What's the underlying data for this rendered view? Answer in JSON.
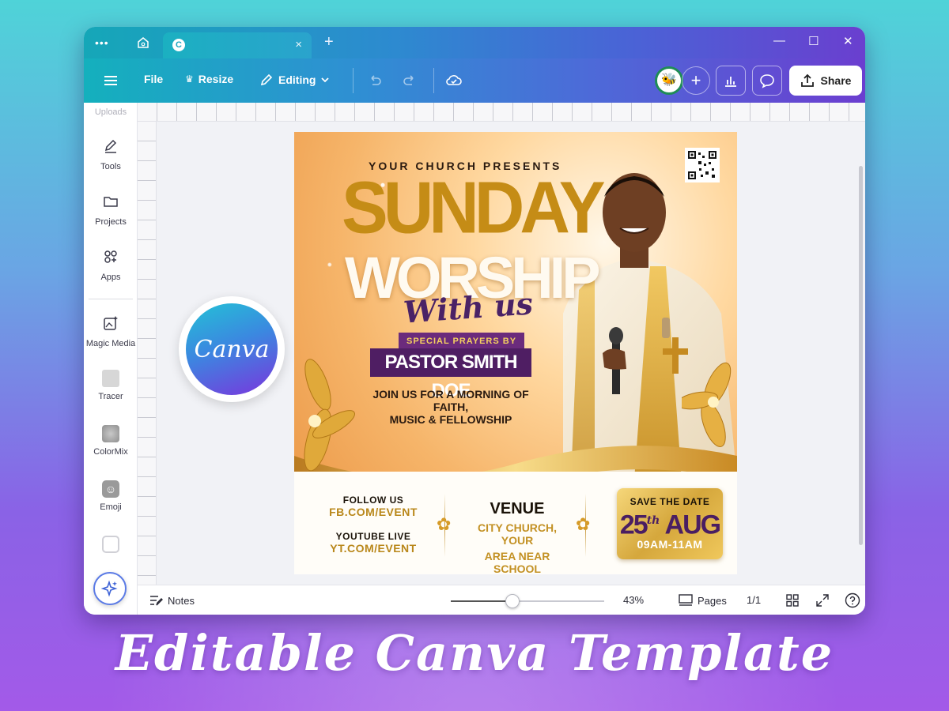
{
  "window": {
    "tab_favicon_letter": "C",
    "tab_close": "×",
    "tab_new": "+",
    "controls": {
      "minimize": "—",
      "maximize": "☐",
      "close": "✕"
    }
  },
  "toolbar": {
    "menu_icon": "hamburger-icon",
    "file": "File",
    "resize": "Resize",
    "editing": "Editing",
    "share": "Share",
    "avatar_glyph": "🐝",
    "add": "+"
  },
  "sidebar": {
    "items": [
      {
        "label": "Uploads",
        "icon": "upload-icon"
      },
      {
        "label": "Tools",
        "icon": "pen-icon"
      },
      {
        "label": "Projects",
        "icon": "folder-icon"
      },
      {
        "label": "Apps",
        "icon": "apps-icon"
      },
      {
        "label": "Magic Media",
        "icon": "magic-media-icon"
      },
      {
        "label": "Tracer",
        "icon": "tracer-icon"
      },
      {
        "label": "ColorMix",
        "icon": "colormix-icon"
      },
      {
        "label": "Emoji",
        "icon": "emoji-icon"
      }
    ]
  },
  "bottom_bar": {
    "notes": "Notes",
    "zoom": "43%",
    "zoom_fraction": 0.4,
    "pages": "Pages",
    "page_count": "1/1"
  },
  "flyer": {
    "top_line": "YOUR CHURCH PRESENTS",
    "title_1": "SUNDAY",
    "title_2": "WORSHIP",
    "script": "With us",
    "special": "SPECIAL PRAYERS BY",
    "pastor": "PASTOR SMITH DOE",
    "join_line_1": "JOIN US FOR  A MORNING OF  FAITH,",
    "join_line_2": "MUSIC & FELLOWSHIP",
    "follow_label": "FOLLOW US",
    "follow_value": "FB.COM/EVENT",
    "youtube_label": "YOUTUBE LIVE",
    "youtube_value": "YT.COM/EVENT",
    "venue_title": "VENUE",
    "venue_line_1": "CITY CHURCH, YOUR",
    "venue_line_2": "AREA NEAR SCHOOL",
    "save_date": "SAVE THE DATE",
    "date_day": "25",
    "date_suffix": "th",
    "date_month": "AUG",
    "date_time": "09AM-11AM"
  },
  "badge": {
    "text": "Canva"
  },
  "caption": "Editable Canva Template"
}
